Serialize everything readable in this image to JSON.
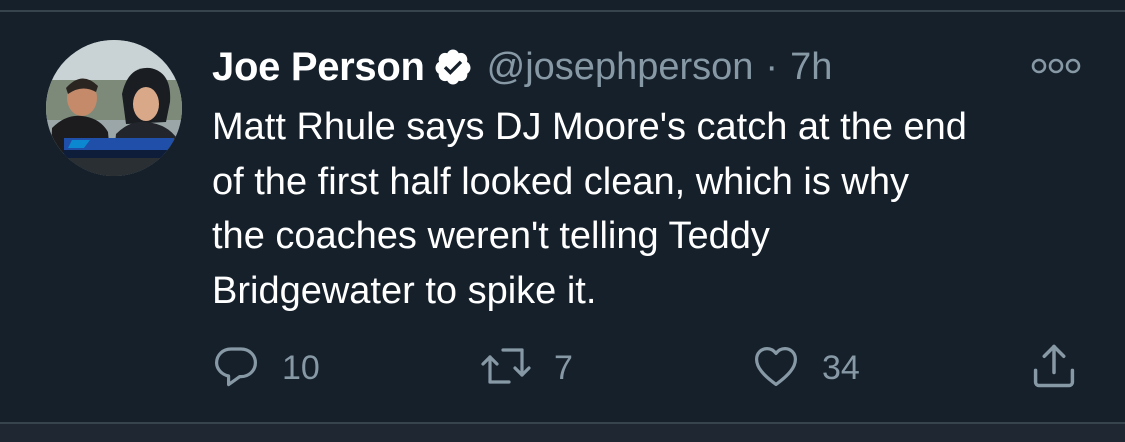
{
  "tweet": {
    "author": {
      "display_name": "Joe Person",
      "handle": "@josephperson",
      "verified": true
    },
    "separator": "·",
    "time": "7h",
    "text_lines": [
      "Matt Rhule says DJ Moore's catch at the end",
      "of the first half looked clean, which is why",
      "the coaches weren't telling Teddy",
      "Bridgewater to spike it."
    ],
    "actions": {
      "replies": "10",
      "retweets": "7",
      "likes": "34"
    }
  },
  "icons": {
    "more": "more-options-icon",
    "reply": "reply-icon",
    "retweet": "retweet-icon",
    "like": "heart-icon",
    "share": "share-icon",
    "verified": "verified-badge-icon"
  },
  "colors": {
    "background": "#15202b",
    "secondary_text": "#8899a6",
    "divider": "#38444d",
    "verified_badge": "#ffffff"
  }
}
